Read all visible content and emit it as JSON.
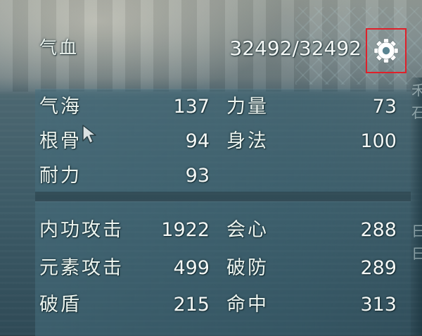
{
  "hp": {
    "label": "气血",
    "value": "32492/32492"
  },
  "settings": {
    "icon": "gear-icon",
    "highlight_color": "#e0202a"
  },
  "attributes": {
    "rows": [
      {
        "left": {
          "label": "气海",
          "value": "137"
        },
        "right": {
          "label": "力量",
          "value": "73"
        }
      },
      {
        "left": {
          "label": "根骨",
          "value": "94"
        },
        "right": {
          "label": "身法",
          "value": "100"
        }
      },
      {
        "left": {
          "label": "耐力",
          "value": "93"
        }
      }
    ]
  },
  "combat": {
    "rows": [
      {
        "left": {
          "label": "内功攻击",
          "value": "1922"
        },
        "right": {
          "label": "会心",
          "value": "288"
        }
      },
      {
        "left": {
          "label": "元素攻击",
          "value": "499"
        },
        "right": {
          "label": "破防",
          "value": "289"
        }
      },
      {
        "left": {
          "label": "破盾",
          "value": "215"
        },
        "right": {
          "label": "命中",
          "value": "313"
        }
      }
    ]
  }
}
